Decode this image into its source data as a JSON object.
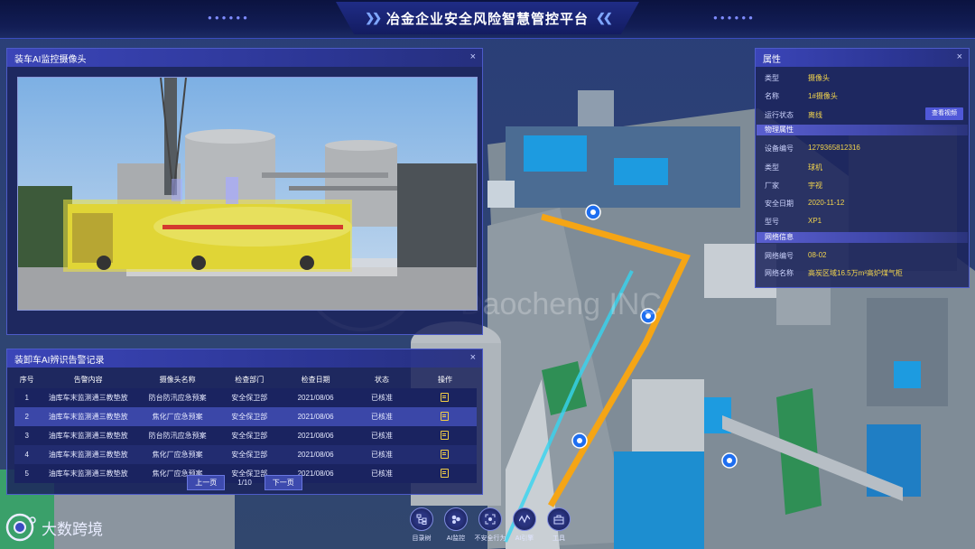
{
  "header": {
    "title": "冶金企业安全风险智慧管控平台"
  },
  "camera_panel": {
    "title": "装车AI监控摄像头",
    "close": "×"
  },
  "alarm_panel": {
    "title": "装卸车AI辨识告警记录",
    "close": "×",
    "columns": [
      "序号",
      "告警内容",
      "摄像头名称",
      "检查部门",
      "检查日期",
      "状态",
      "操作"
    ],
    "rows": [
      {
        "no": "1",
        "content": "油库车末监测通三教垫放",
        "camera": "防台防汛应急预案",
        "dept": "安全保卫部",
        "date": "2021/08/06",
        "status": "已核准"
      },
      {
        "no": "2",
        "content": "油库车末监测通三教垫放",
        "camera": "焦化厂应急预案",
        "dept": "安全保卫部",
        "date": "2021/08/06",
        "status": "已核准"
      },
      {
        "no": "3",
        "content": "油库车末监测通三教垫放",
        "camera": "防台防汛应急预案",
        "dept": "安全保卫部",
        "date": "2021/08/06",
        "status": "已核准"
      },
      {
        "no": "4",
        "content": "油库车末监测通三教垫放",
        "camera": "焦化厂应急预案",
        "dept": "安全保卫部",
        "date": "2021/08/06",
        "status": "已核准"
      },
      {
        "no": "5",
        "content": "油库车末监测通三教垫放",
        "camera": "焦化厂应急预案",
        "dept": "安全保卫部",
        "date": "2021/08/06",
        "status": "已核准"
      }
    ],
    "pager": {
      "prev": "上一页",
      "page": "1/10",
      "next": "下一页"
    }
  },
  "properties": {
    "title": "属性",
    "close": "×",
    "type_label": "类型",
    "type_value": "摄像头",
    "name_label": "名称",
    "name_value": "1#摄像头",
    "status_label": "运行状态",
    "status_value": "离线",
    "view_video": "查看视频",
    "physical_title": "物理属性",
    "device_no_label": "设备编号",
    "device_no_value": "1279365812316",
    "ptype_label": "类型",
    "ptype_value": "球机",
    "vendor_label": "厂家",
    "vendor_value": "宇视",
    "install_label": "安全日期",
    "install_value": "2020-11-12",
    "model_label": "型号",
    "model_value": "XP1",
    "network_title": "网络信息",
    "net_no_label": "网络编号",
    "net_no_value": "08-02",
    "net_name_label": "网络名称",
    "net_name_value": "高炭区域16.5万m³高炉煤气柜"
  },
  "toolbar": [
    {
      "label": "目录树",
      "icon": "tree-icon"
    },
    {
      "label": "AI监控",
      "icon": "ai-monitor-icon"
    },
    {
      "label": "不安全行为",
      "icon": "unsafe-behavior-icon"
    },
    {
      "label": "AI引擎",
      "icon": "ai-engine-icon"
    },
    {
      "label": "工具",
      "icon": "toolbox-icon"
    }
  ],
  "logo": {
    "text": "大数跨境"
  },
  "watermark": {
    "text": "Daocheng INC"
  },
  "colors": {
    "accent": "#4d5bc9",
    "value_yellow": "#f2d44d",
    "route_orange": "#f5a515"
  }
}
